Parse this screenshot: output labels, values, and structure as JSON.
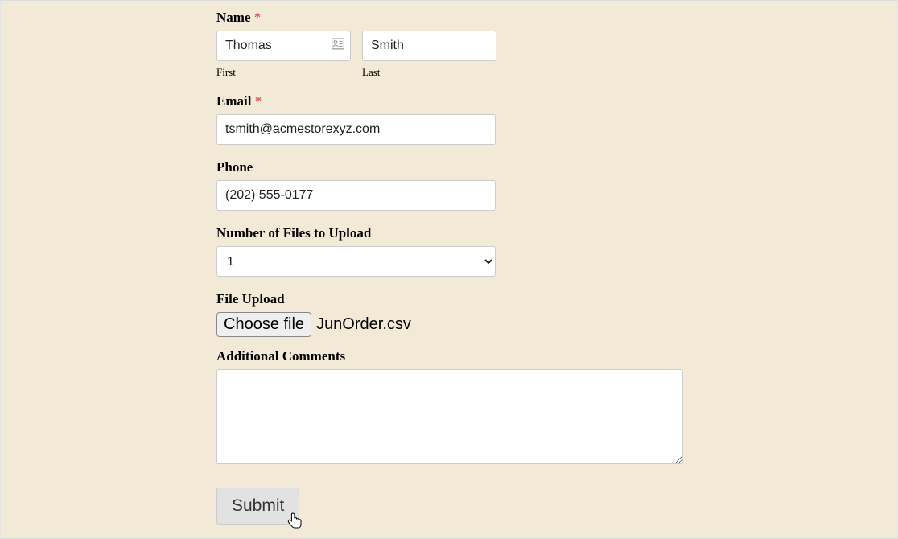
{
  "labels": {
    "name": "Name",
    "first": "First",
    "last": "Last",
    "email": "Email",
    "phone": "Phone",
    "numFiles": "Number of Files to Upload",
    "fileUpload": "File Upload",
    "chooseFile": "Choose file",
    "comments": "Additional Comments",
    "submit": "Submit"
  },
  "required_mark": "*",
  "values": {
    "firstName": "Thomas",
    "lastName": "Smith",
    "email": "tsmith@acmestorexyz.com",
    "phone": "(202) 555-0177",
    "numFiles": "1",
    "fileName": "JunOrder.csv",
    "comments": ""
  }
}
